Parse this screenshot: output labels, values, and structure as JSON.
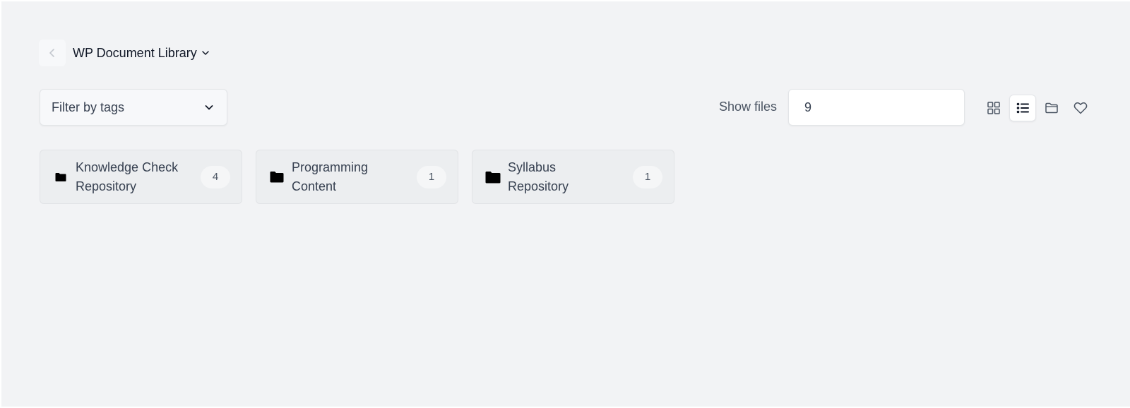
{
  "header": {
    "back_icon": "chevron-left-icon",
    "library_title": "WP Document Library",
    "title_caret_icon": "chevron-down-icon"
  },
  "filter": {
    "label": "Filter by tags",
    "icon": "chevron-down-icon"
  },
  "show_files": {
    "label": "Show files",
    "value": "9"
  },
  "view_controls": [
    {
      "icon": "grid-view-icon",
      "active": false
    },
    {
      "icon": "list-view-icon",
      "active": true
    },
    {
      "icon": "folder-view-icon",
      "active": false
    },
    {
      "icon": "heart-icon",
      "active": false
    }
  ],
  "folders": [
    {
      "name_line1": "Knowledge Check",
      "name_line2": "Repository",
      "count": "4",
      "icon": "folder-icon"
    },
    {
      "name_line1": "Programming",
      "name_line2": "Content",
      "count": "1",
      "icon": "folder-icon"
    },
    {
      "name_line1": "Syllabus",
      "name_line2": "Repository",
      "count": "1",
      "icon": "folder-icon"
    }
  ],
  "colors": {
    "background": "#f2f3f5",
    "card_background": "#eceef0",
    "text_primary": "#111827",
    "text_secondary": "#374151"
  }
}
